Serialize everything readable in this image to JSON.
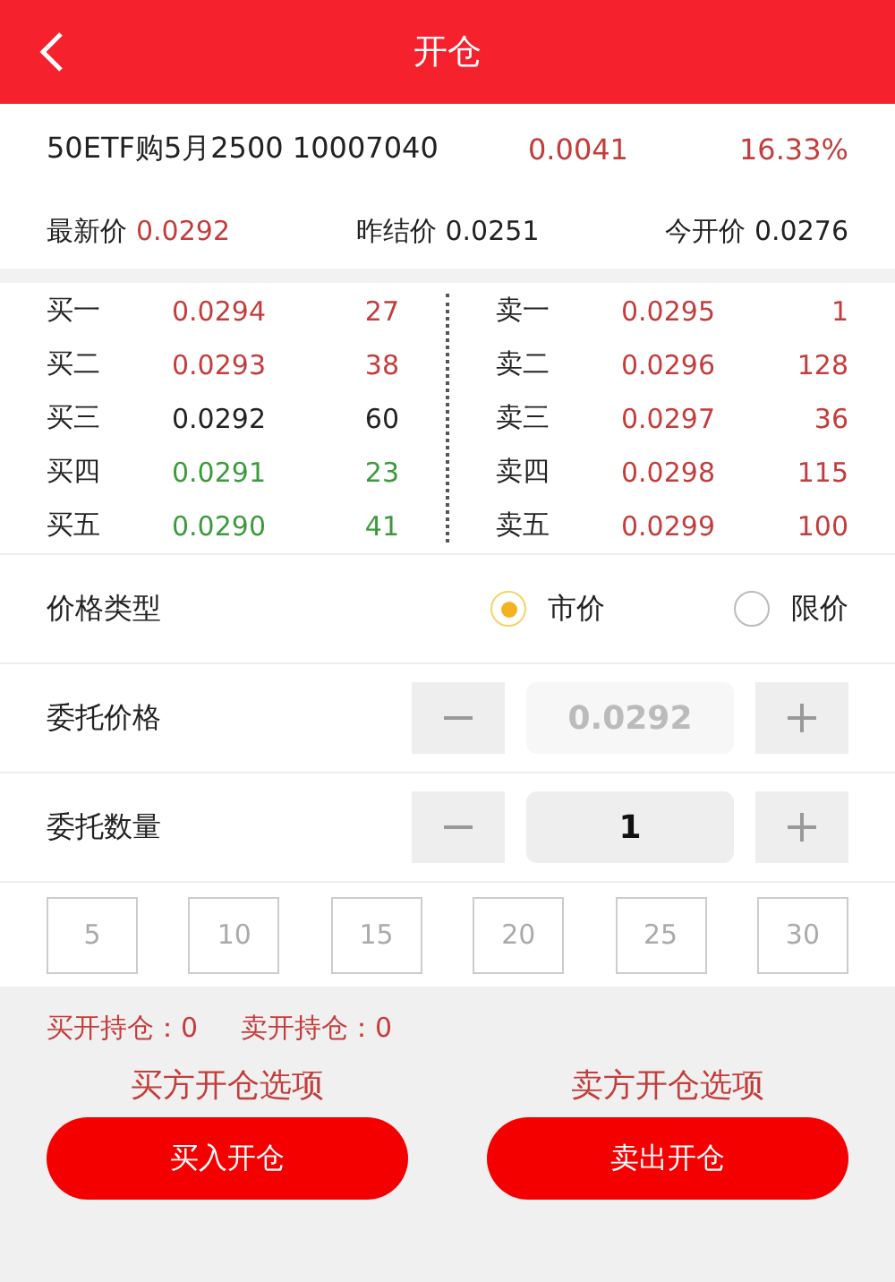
{
  "header": {
    "title": "开仓"
  },
  "quote": {
    "name": "50ETF购5月2500 10007040",
    "change": "0.0041",
    "change_percent": "16.33%",
    "color": "#c43c3c"
  },
  "stats": [
    {
      "label": "最新价",
      "value": "0.0292",
      "color": "#c43c3c"
    },
    {
      "label": "昨结价",
      "value": "0.0251",
      "color": "#222222"
    },
    {
      "label": "今开价",
      "value": "0.0276",
      "color": "#222222"
    }
  ],
  "bids": [
    {
      "label": "买一",
      "price": "0.0294",
      "qty": "27",
      "color": "#c43c3c"
    },
    {
      "label": "买二",
      "price": "0.0293",
      "qty": "38",
      "color": "#c43c3c"
    },
    {
      "label": "买三",
      "price": "0.0292",
      "qty": "60",
      "color": "#222222"
    },
    {
      "label": "买四",
      "price": "0.0291",
      "qty": "23",
      "color": "#3c9a3c"
    },
    {
      "label": "买五",
      "price": "0.0290",
      "qty": "41",
      "color": "#3c9a3c"
    }
  ],
  "asks": [
    {
      "label": "卖一",
      "price": "0.0295",
      "qty": "1",
      "color": "#c43c3c"
    },
    {
      "label": "卖二",
      "price": "0.0296",
      "qty": "128",
      "color": "#c43c3c"
    },
    {
      "label": "卖三",
      "price": "0.0297",
      "qty": "36",
      "color": "#c43c3c"
    },
    {
      "label": "卖四",
      "price": "0.0298",
      "qty": "115",
      "color": "#c43c3c"
    },
    {
      "label": "卖五",
      "price": "0.0299",
      "qty": "100",
      "color": "#c43c3c"
    }
  ],
  "price_type": {
    "label": "价格类型",
    "options": [
      {
        "label": "市价",
        "selected": true
      },
      {
        "label": "限价",
        "selected": false
      }
    ]
  },
  "steppers": [
    {
      "label": "委托价格",
      "value": "0.0292",
      "disabled": true
    },
    {
      "label": "委托数量",
      "value": "1",
      "disabled": false
    }
  ],
  "quick_amounts": [
    "5",
    "10",
    "15",
    "20",
    "25",
    "30"
  ],
  "positions": [
    {
      "label": "买开持仓：",
      "value": "0"
    },
    {
      "label": "卖开持仓：",
      "value": "0"
    }
  ],
  "actions": [
    {
      "caption": "买方开仓选项",
      "button": "买入开仓"
    },
    {
      "caption": "卖方开仓选项",
      "button": "卖出开仓"
    }
  ]
}
